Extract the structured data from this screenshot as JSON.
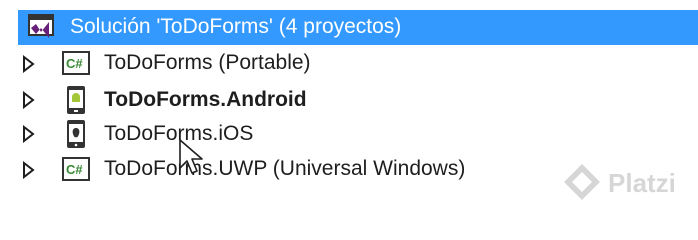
{
  "solution": {
    "label": "Solución 'ToDoForms'  (4 proyectos)",
    "icon": "visual-studio-solution-icon"
  },
  "projects": [
    {
      "label": "ToDoForms (Portable)",
      "icon": "csharp-project-icon",
      "bold": false
    },
    {
      "label": "ToDoForms.Android",
      "icon": "android-phone-icon",
      "bold": true
    },
    {
      "label": "ToDoForms.iOS",
      "icon": "ios-phone-icon",
      "bold": false
    },
    {
      "label": "ToDoForms.UWP (Universal Windows)",
      "icon": "csharp-project-icon",
      "bold": false
    }
  ],
  "csharp_badge_text": "C#",
  "watermark": {
    "text": "Platzi",
    "icon": "platzi-logo-icon"
  },
  "colors": {
    "selection": "#3399ff",
    "vs_purple": "#68217a",
    "csharp_green": "#388a34",
    "android_green": "#a4c639"
  }
}
